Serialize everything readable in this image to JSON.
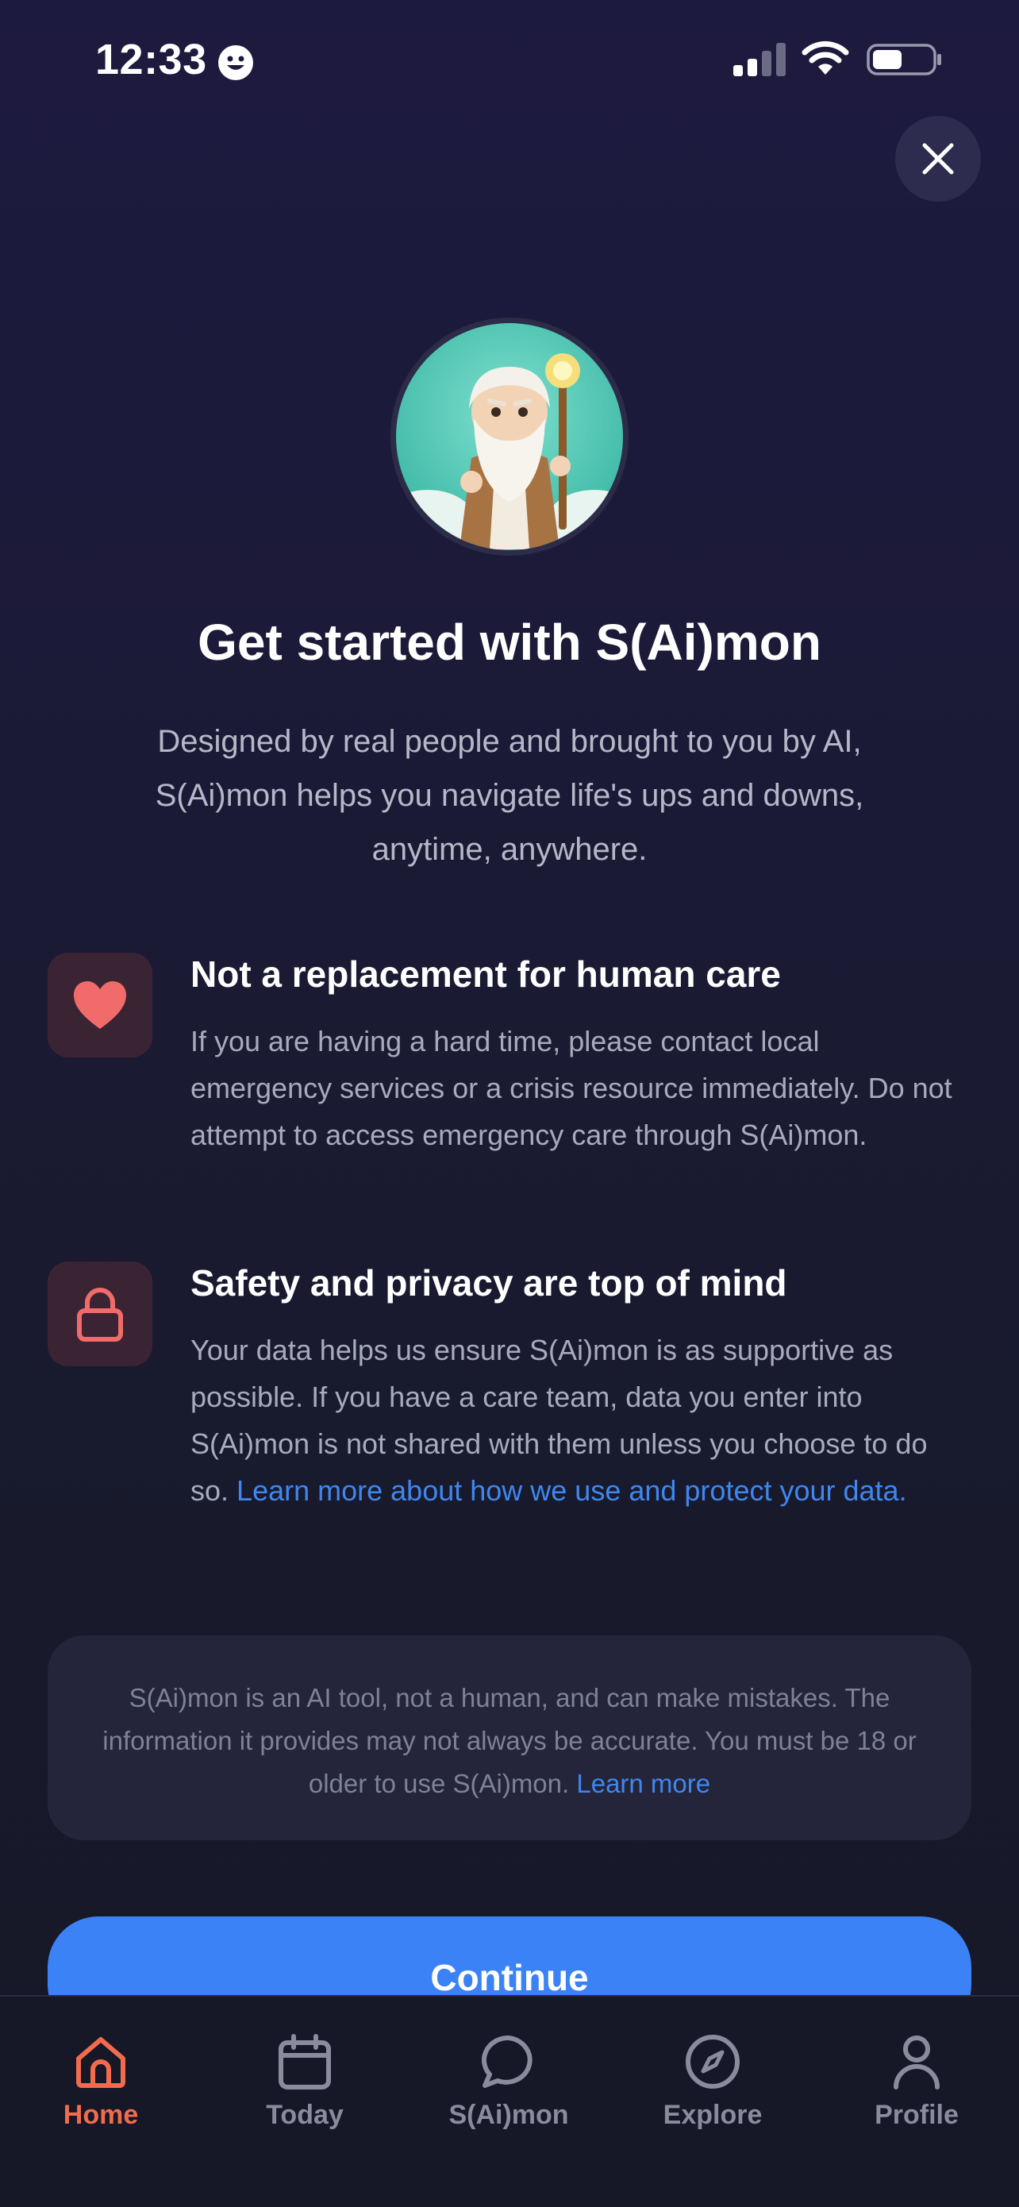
{
  "status_bar": {
    "time": "12:33"
  },
  "onboarding": {
    "title": "Get started with S(Ai)mon",
    "subtitle": "Designed by real people and brought to you by AI, S(Ai)mon helps you navigate life's ups and downs, anytime, anywhere.",
    "features": [
      {
        "icon": "heart-icon",
        "title": "Not a replacement for human care",
        "body": "If you are having a hard time, please contact local emergency services or a crisis resource immediately. Do not attempt to access emergency care through S(Ai)mon."
      },
      {
        "icon": "lock-icon",
        "title": "Safety and privacy are top of mind",
        "body": "Your data helps us ensure S(Ai)mon is as supportive as possible. If you have a care team, data you enter into S(Ai)mon is not shared with them unless you choose to do so.",
        "link": "Learn more about how we use and protect your data."
      }
    ],
    "disclaimer": {
      "text": "S(Ai)mon is an AI tool, not a human, and can make mistakes. The information it provides may not always be accurate. You must be 18 or older to use S(Ai)mon.",
      "link": "Learn more"
    },
    "continue_label": "Continue"
  },
  "tab_bar": {
    "items": [
      {
        "label": "Home",
        "icon": "home-icon",
        "active": true
      },
      {
        "label": "Today",
        "icon": "calendar-icon",
        "active": false
      },
      {
        "label": "S(Ai)mon",
        "icon": "chat-bubble-icon",
        "active": false
      },
      {
        "label": "Explore",
        "icon": "compass-icon",
        "active": false
      },
      {
        "label": "Profile",
        "icon": "person-icon",
        "active": false
      }
    ]
  },
  "colors": {
    "accent_blue": "#3b82f6",
    "active_tab": "#f26b4c",
    "icon_coral": "#f26b6b",
    "link_blue": "#3f87ef"
  }
}
